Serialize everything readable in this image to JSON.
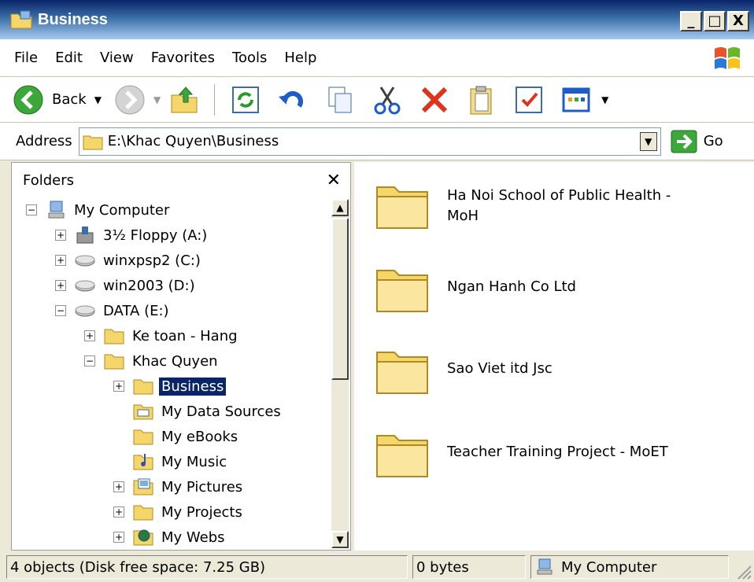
{
  "window": {
    "title": "Business"
  },
  "title_buttons": {
    "minimize": "_",
    "maximize": "□",
    "close": "X"
  },
  "menu": [
    "File",
    "Edit",
    "View",
    "Favorites",
    "Tools",
    "Help"
  ],
  "toolbar": {
    "back_label": "Back"
  },
  "address": {
    "label": "Address",
    "value": "E:\\Khac Quyen\\Business",
    "go_label": "Go"
  },
  "folders_pane": {
    "header": "Folders",
    "tree": [
      {
        "label": "My Computer",
        "depth": 0,
        "expander": "−",
        "icon": "computer-icon"
      },
      {
        "label": "3½ Floppy (A:)",
        "depth": 1,
        "expander": "+",
        "icon": "floppy-icon"
      },
      {
        "label": "winxpsp2 (C:)",
        "depth": 1,
        "expander": "+",
        "icon": "drive-icon"
      },
      {
        "label": "win2003 (D:)",
        "depth": 1,
        "expander": "+",
        "icon": "drive-icon"
      },
      {
        "label": "DATA (E:)",
        "depth": 1,
        "expander": "−",
        "icon": "drive-icon"
      },
      {
        "label": "Ke toan - Hang",
        "depth": 2,
        "expander": "+",
        "icon": "folder-icon"
      },
      {
        "label": "Khac Quyen",
        "depth": 2,
        "expander": "−",
        "icon": "folder-icon"
      },
      {
        "label": "Business",
        "depth": 3,
        "expander": "+",
        "icon": "folder-icon",
        "selected": true
      },
      {
        "label": "My Data Sources",
        "depth": 3,
        "expander": "",
        "icon": "data-sources-icon"
      },
      {
        "label": "My eBooks",
        "depth": 3,
        "expander": "",
        "icon": "folder-icon"
      },
      {
        "label": "My Music",
        "depth": 3,
        "expander": "",
        "icon": "music-folder-icon"
      },
      {
        "label": "My Pictures",
        "depth": 3,
        "expander": "+",
        "icon": "pictures-folder-icon"
      },
      {
        "label": "My Projects",
        "depth": 3,
        "expander": "+",
        "icon": "folder-icon"
      },
      {
        "label": "My Webs",
        "depth": 3,
        "expander": "+",
        "icon": "webs-folder-icon"
      }
    ]
  },
  "files": [
    {
      "name": "Ha Noi School of Public Health - MoH"
    },
    {
      "name": "Ngan Hanh Co Ltd"
    },
    {
      "name": "Sao Viet itd Jsc"
    },
    {
      "name": "Teacher Training Project - MoET"
    }
  ],
  "status": {
    "objects": "4 objects (Disk free space: 7.25 GB)",
    "size": "0 bytes",
    "location": "My Computer"
  },
  "colors": {
    "selection": "#0a246a",
    "folder": "#f5d66b",
    "titlebar": "#0a246a"
  }
}
